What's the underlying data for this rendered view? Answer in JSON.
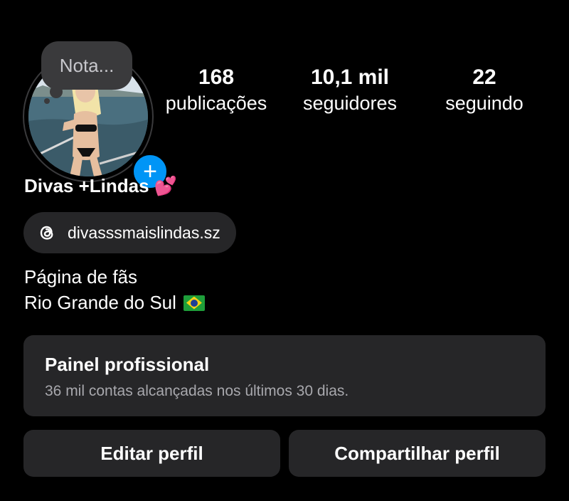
{
  "note": {
    "placeholder": "Nota..."
  },
  "profile": {
    "name": "Divas +Lindas",
    "name_emoji": "💕",
    "avatar_icon": "profile-photo",
    "add_story_icon": "plus-icon"
  },
  "stats": {
    "posts": {
      "value": "168",
      "label": "publicações"
    },
    "followers": {
      "value": "10,1 mil",
      "label": "seguidores"
    },
    "following": {
      "value": "22",
      "label": "seguindo"
    }
  },
  "threads": {
    "icon": "threads-icon",
    "handle": "divasssmaislindas.sz"
  },
  "bio": {
    "line1": "Página de fãs",
    "line2": "Rio Grande do Sul",
    "flag_icon": "brazil-flag-icon"
  },
  "pro_panel": {
    "title": "Painel profissional",
    "subtitle": "36 mil contas alcançadas nos últimos 30 dias."
  },
  "buttons": {
    "edit": "Editar perfil",
    "share": "Compartilhar perfil"
  },
  "colors": {
    "background": "#000000",
    "surface": "#262628",
    "accent": "#0095f6",
    "secondary_text": "#a8a8ad"
  }
}
